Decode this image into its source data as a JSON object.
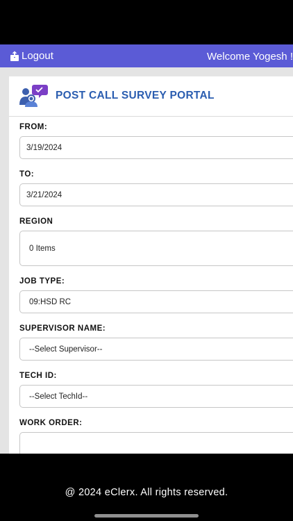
{
  "header": {
    "logout_label": "Logout",
    "welcome_text": "Welcome Yogesh !",
    "bar_color": "#5b5bd6"
  },
  "portal": {
    "title": "POST CALL SURVEY PORTAL",
    "logo_icon": "survey-agent-icon"
  },
  "form": {
    "from_label": "FROM:",
    "from_value": "3/19/2024",
    "to_label": "TO:",
    "to_value": "3/21/2024",
    "region_label": "REGION",
    "region_value": "0 Items",
    "job_type_label": "JOB TYPE:",
    "job_type_value": "09:HSD RC",
    "supervisor_label": "SUPERVISOR NAME:",
    "supervisor_value": "--Select Supervisor--",
    "tech_id_label": "TECH ID:",
    "tech_id_value": "--Select TechId--",
    "work_order_label": "WORK ORDER:",
    "work_order_value": ""
  },
  "footer": {
    "copyright": "@ 2024 eClerx. All rights reserved."
  }
}
